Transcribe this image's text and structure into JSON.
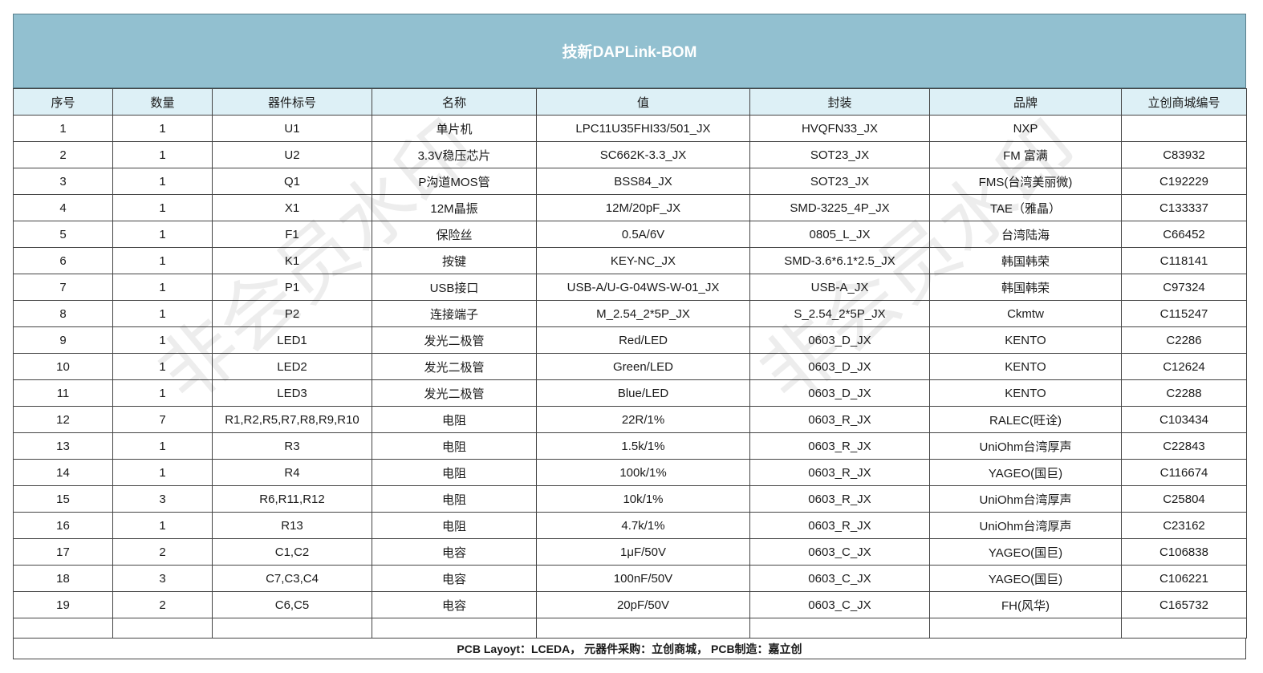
{
  "title": "技新DAPLink-BOM",
  "columns": [
    "序号",
    "数量",
    "器件标号",
    "名称",
    "值",
    "封装",
    "品牌",
    "立创商城编号"
  ],
  "rows": [
    [
      "1",
      "1",
      "U1",
      "单片机",
      "LPC11U35FHI33/501_JX",
      "HVQFN33_JX",
      "NXP",
      ""
    ],
    [
      "2",
      "1",
      "U2",
      "3.3V稳压芯片",
      "SC662K-3.3_JX",
      "SOT23_JX",
      "FM 富满",
      "C83932"
    ],
    [
      "3",
      "1",
      "Q1",
      "P沟道MOS管",
      "BSS84_JX",
      "SOT23_JX",
      "FMS(台湾美丽微)",
      "C192229"
    ],
    [
      "4",
      "1",
      "X1",
      "12M晶振",
      "12M/20pF_JX",
      "SMD-3225_4P_JX",
      "TAE（雅晶）",
      "C133337"
    ],
    [
      "5",
      "1",
      "F1",
      "保险丝",
      "0.5A/6V",
      "0805_L_JX",
      "台湾陆海",
      "C66452"
    ],
    [
      "6",
      "1",
      "K1",
      "按键",
      "KEY-NC_JX",
      "SMD-3.6*6.1*2.5_JX",
      "韩国韩荣",
      "C118141"
    ],
    [
      "7",
      "1",
      "P1",
      "USB接口",
      "USB-A/U-G-04WS-W-01_JX",
      "USB-A_JX",
      "韩国韩荣",
      "C97324"
    ],
    [
      "8",
      "1",
      "P2",
      "连接端子",
      "M_2.54_2*5P_JX",
      "S_2.54_2*5P_JX",
      "Ckmtw",
      "C115247"
    ],
    [
      "9",
      "1",
      "LED1",
      "发光二极管",
      "Red/LED",
      "0603_D_JX",
      "KENTO",
      "C2286"
    ],
    [
      "10",
      "1",
      "LED2",
      "发光二极管",
      "Green/LED",
      "0603_D_JX",
      "KENTO",
      "C12624"
    ],
    [
      "11",
      "1",
      "LED3",
      "发光二极管",
      "Blue/LED",
      "0603_D_JX",
      "KENTO",
      "C2288"
    ],
    [
      "12",
      "7",
      "R1,R2,R5,R7,R8,R9,R10",
      "电阻",
      "22R/1%",
      "0603_R_JX",
      "RALEC(旺诠)",
      "C103434"
    ],
    [
      "13",
      "1",
      "R3",
      "电阻",
      "1.5k/1%",
      "0603_R_JX",
      "UniOhm台湾厚声",
      "C22843"
    ],
    [
      "14",
      "1",
      "R4",
      "电阻",
      "100k/1%",
      "0603_R_JX",
      "YAGEO(国巨)",
      "C116674"
    ],
    [
      "15",
      "3",
      "R6,R11,R12",
      "电阻",
      "10k/1%",
      "0603_R_JX",
      "UniOhm台湾厚声",
      "C25804"
    ],
    [
      "16",
      "1",
      "R13",
      "电阻",
      "4.7k/1%",
      "0603_R_JX",
      "UniOhm台湾厚声",
      "C23162"
    ],
    [
      "17",
      "2",
      "C1,C2",
      "电容",
      "1μF/50V",
      "0603_C_JX",
      "YAGEO(国巨)",
      "C106838"
    ],
    [
      "18",
      "3",
      "C7,C3,C4",
      "电容",
      "100nF/50V",
      "0603_C_JX",
      "YAGEO(国巨)",
      "C106221"
    ],
    [
      "19",
      "2",
      "C6,C5",
      "电容",
      "20pF/50V",
      "0603_C_JX",
      "FH(风华)",
      "C165732"
    ]
  ],
  "footer": "PCB Layoyt：LCEDA，  元器件采购：立创商城，  PCB制造：嘉立创",
  "watermark": "非会员水印",
  "colors": {
    "title_bg": "#92c0d0",
    "header_bg": "#ddf0f6",
    "watermark": "rgba(0,0,0,0.07)"
  }
}
